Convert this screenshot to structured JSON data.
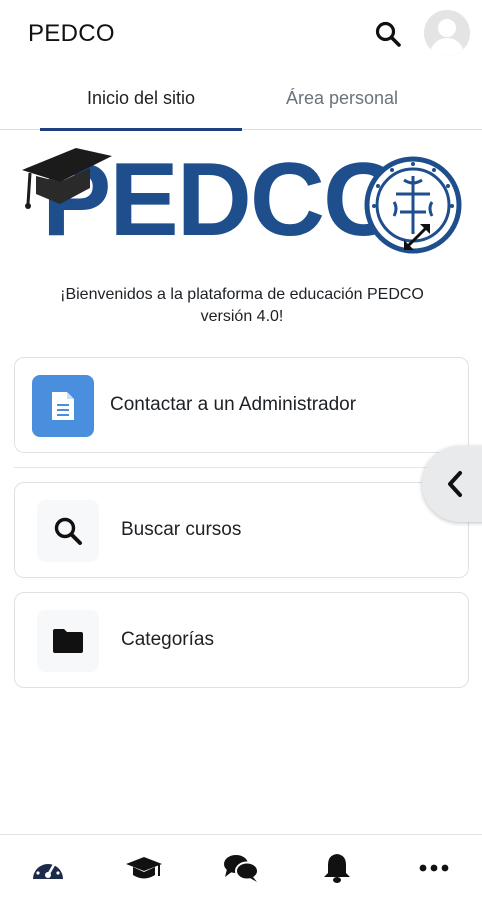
{
  "header": {
    "title": "PEDCO",
    "search_icon": "search-icon",
    "avatar_icon": "user-avatar-icon"
  },
  "tabs": [
    {
      "label": "Inicio del sitio",
      "active": true
    },
    {
      "label": "Área personal",
      "active": false
    }
  ],
  "logo": {
    "text": "PEDCO",
    "icons": [
      "graduation-cap-icon",
      "university-seal-icon"
    ]
  },
  "welcome": {
    "line1": "¡Bienvenidos a la plataforma de educación PEDCO",
    "line2": "versión 4.0!"
  },
  "cards": [
    {
      "label": "Contactar a un Administrador",
      "icon": "document-icon"
    },
    {
      "label": "Buscar cursos",
      "icon": "search-icon"
    },
    {
      "label": "Categorías",
      "icon": "folder-icon"
    }
  ],
  "bottom_nav": [
    {
      "icon": "dashboard-gauge-icon",
      "active": true
    },
    {
      "icon": "graduation-cap-icon",
      "active": false
    },
    {
      "icon": "messages-icon",
      "active": false
    },
    {
      "icon": "notifications-bell-icon",
      "active": false
    },
    {
      "icon": "more-icon",
      "active": false
    }
  ],
  "colors": {
    "brand": "#1f4e8c",
    "tab_indicator": "#1f3f80",
    "tile_blue": "#4a8fde",
    "nav_icon": "#1d2b4a"
  }
}
